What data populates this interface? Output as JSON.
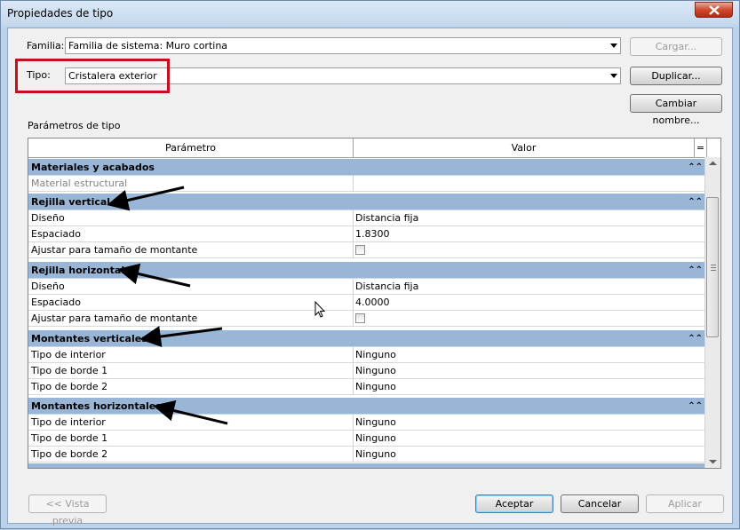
{
  "window": {
    "title": "Propiedades de tipo"
  },
  "familia": {
    "label": "Familia:",
    "value": "Familia de sistema: Muro cortina"
  },
  "tipo": {
    "label": "Tipo:",
    "value": "Cristalera exterior"
  },
  "buttons": {
    "cargar": "Cargar...",
    "duplicar": "Duplicar...",
    "cambiar_nombre": "Cambiar nombre...",
    "vista_previa": "<< Vista previa",
    "aceptar": "Aceptar",
    "cancelar": "Cancelar",
    "aplicar": "Aplicar"
  },
  "section_label": "Parámetros de tipo",
  "table": {
    "headers": [
      "Parámetro",
      "Valor",
      "="
    ],
    "groups": [
      {
        "name": "Materiales y acabados",
        "rows": [
          {
            "param": "Material estructural",
            "value": ""
          }
        ]
      },
      {
        "name": "Rejilla vertical",
        "rows": [
          {
            "param": "Diseño",
            "value": "Distancia fija"
          },
          {
            "param": "Espaciado",
            "value": "1.8300"
          },
          {
            "param": "Ajustar para tamaño de montante",
            "value": ""
          }
        ]
      },
      {
        "name": "Rejilla horizontal",
        "rows": [
          {
            "param": "Diseño",
            "value": "Distancia fija"
          },
          {
            "param": "Espaciado",
            "value": "4.0000"
          },
          {
            "param": "Ajustar para tamaño de montante",
            "value": ""
          }
        ]
      },
      {
        "name": "Montantes verticales",
        "rows": [
          {
            "param": "Tipo de interior",
            "value": "Ninguno"
          },
          {
            "param": "Tipo de borde 1",
            "value": "Ninguno"
          },
          {
            "param": "Tipo de borde 2",
            "value": "Ninguno"
          }
        ]
      },
      {
        "name": "Montantes horizontales",
        "rows": [
          {
            "param": "Tipo de interior",
            "value": "Ninguno"
          },
          {
            "param": "Tipo de borde 1",
            "value": "Ninguno"
          },
          {
            "param": "Tipo de borde 2",
            "value": "Ninguno"
          }
        ]
      }
    ]
  },
  "icons": {
    "collapse": "double-chevron-up-icon",
    "close": "close-icon",
    "checkbox": "checkbox-icon",
    "arrow": "annotation-arrow-icon",
    "cursor": "mouse-cursor-icon"
  },
  "colors": {
    "group_header": "#9ab6d6",
    "highlight_box": "#c1121c",
    "close_button": "#d0492f"
  }
}
